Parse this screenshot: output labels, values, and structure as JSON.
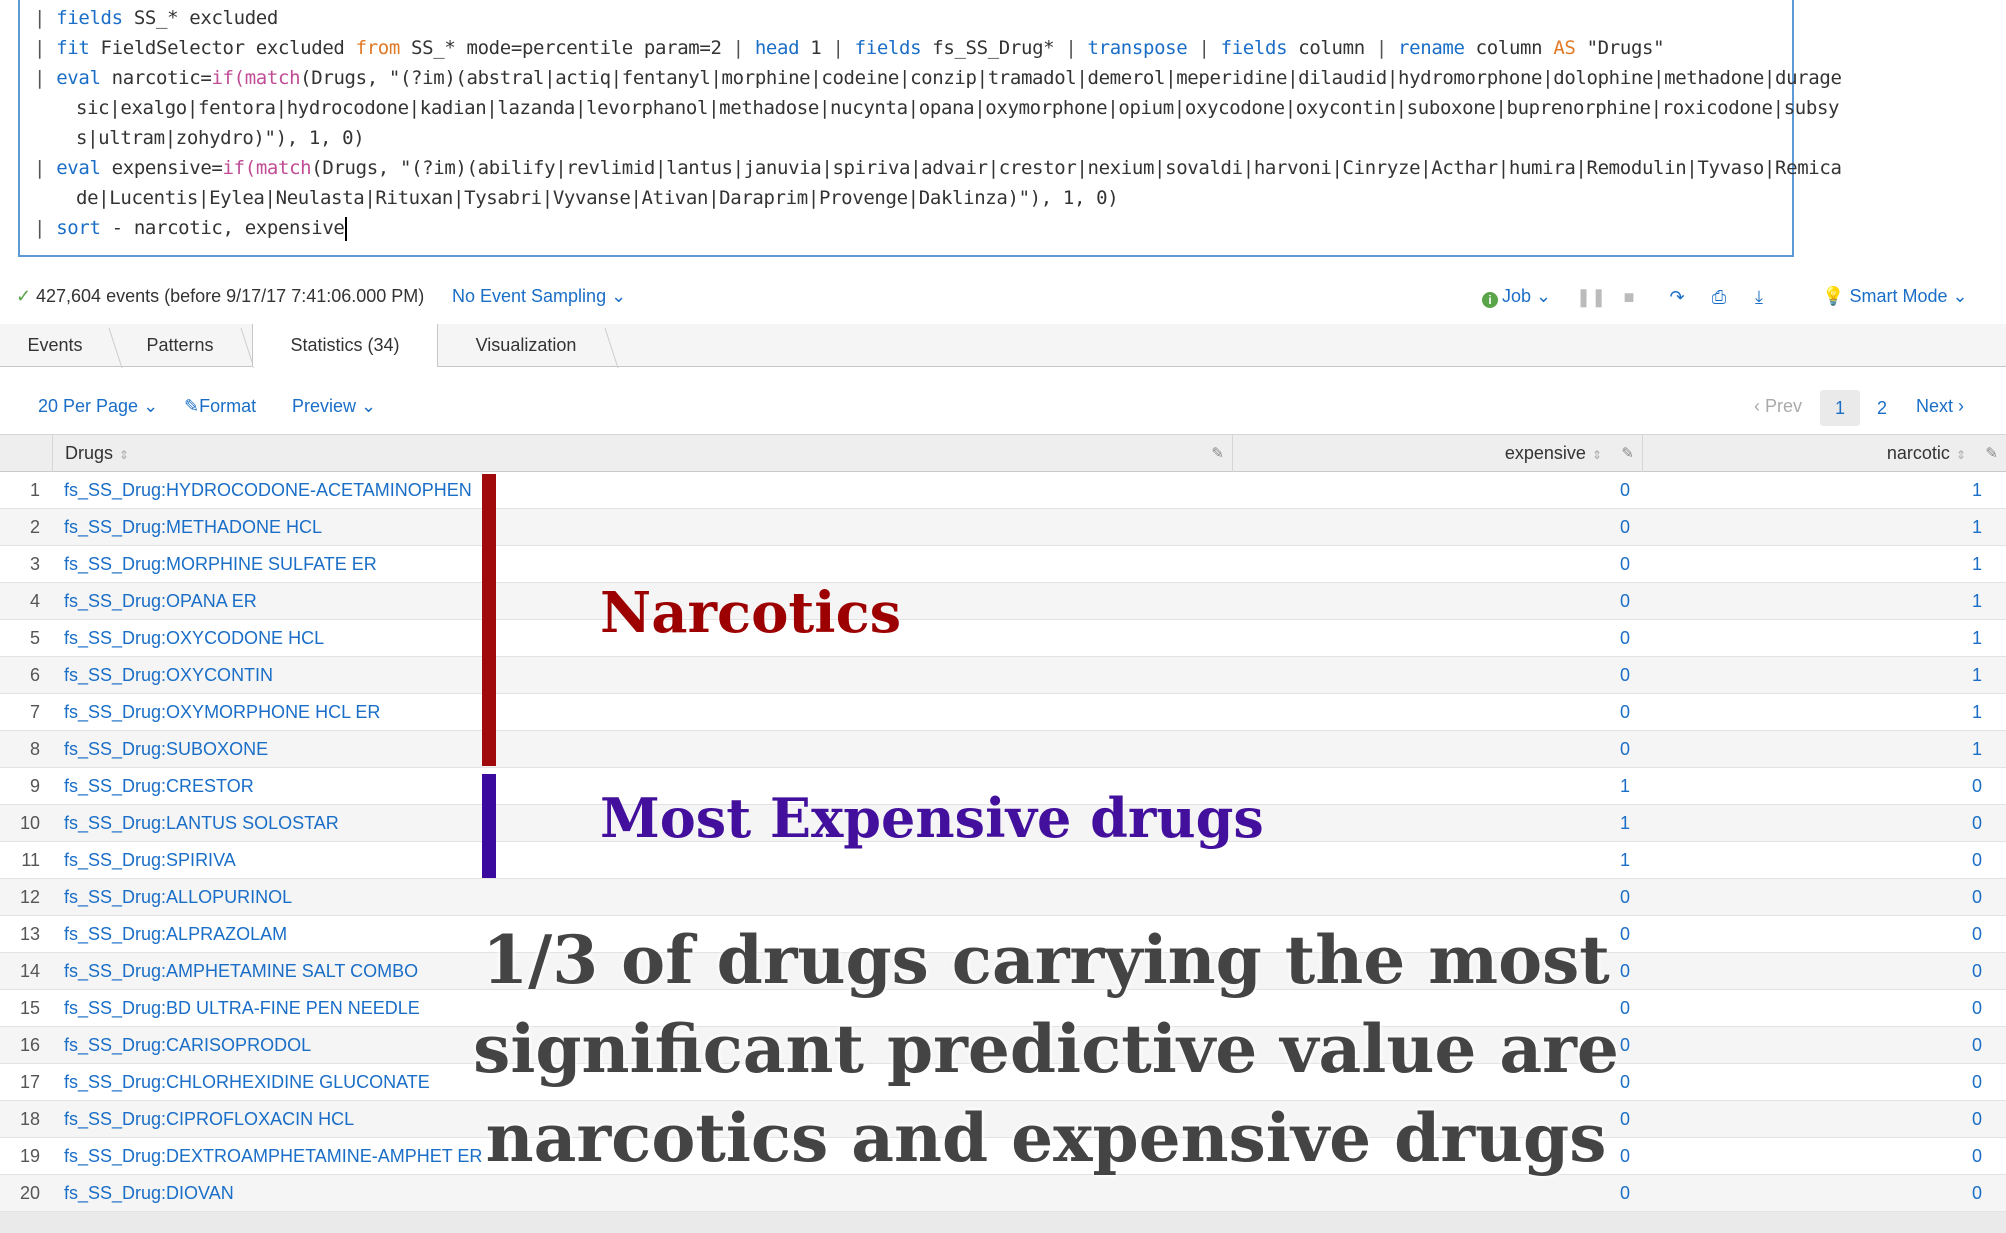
{
  "query": {
    "line1": {
      "pipe": "|",
      "kw": "fields",
      "rest": " SS_* excluded"
    },
    "line2": {
      "pipe": "|",
      "kw1": "fit",
      "t1": " FieldSelector excluded ",
      "op1": "from",
      "t2": " SS_* mode=percentile param=2 ",
      "p2": "|",
      "kw2": " head",
      "t3": " 1 ",
      "p3": "|",
      "kw3": " fields",
      "t4": " fs_SS_Drug* ",
      "p4": "|",
      "kw4": " transpose",
      "t5": " ",
      "p5": "|",
      "kw5": " fields",
      "t6": " column ",
      "p6": "|",
      "kw6": " rename",
      "t7": " column ",
      "op2": "AS",
      "t8": " \"Drugs\""
    },
    "line3": {
      "pipe": "|",
      "kw": "eval",
      "t1": " narcotic=",
      "fn1": "if(",
      "fn2": "match",
      "t2": "(Drugs, \"(?im)(abstral|actiq|fentanyl|morphine|codeine|conzip|tramadol|demerol|meperidine|dilaudid|hydromorphone|dolophine|methadone|durage"
    },
    "line4": "sic|exalgo|fentora|hydrocodone|kadian|lazanda|levorphanol|methadose|nucynta|opana|oxymorphone|opium|oxycodone|oxycontin|suboxone|buprenorphine|roxicodone|subsy",
    "line5": "s|ultram|zohydro)\"), 1, 0)",
    "line6": {
      "pipe": "|",
      "kw": "eval",
      "t1": " expensive=",
      "fn1": "if(",
      "fn2": "match",
      "t2": "(Drugs, \"(?im)(abilify|revlimid|lantus|januvia|spiriva|advair|crestor|nexium|sovaldi|harvoni|Cinryze|Acthar|humira|Remodulin|Tyvaso|Remica"
    },
    "line7": "de|Lucentis|Eylea|Neulasta|Rituxan|Tysabri|Vyvanse|Ativan|Daraprim|Provenge|Daklinza)\"), 1, 0)",
    "line8": {
      "pipe": "|",
      "kw": "sort",
      "rest": " - narcotic, expensive"
    }
  },
  "status": {
    "event_count": "427,604 events (before 9/17/17 7:41:06.000 PM)",
    "sampling": "No Event Sampling",
    "job": "Job",
    "smart_mode": "Smart Mode"
  },
  "tabs": [
    {
      "label": "Events"
    },
    {
      "label": "Patterns"
    },
    {
      "label": "Statistics (34)"
    },
    {
      "label": "Visualization"
    }
  ],
  "toolbar": {
    "per_page": "20 Per Page",
    "format": "Format",
    "preview": "Preview",
    "prev": "Prev",
    "page1": "1",
    "page2": "2",
    "next": "Next"
  },
  "table": {
    "headers": {
      "drugs": "Drugs",
      "expensive": "expensive",
      "narcotic": "narcotic"
    },
    "rows": [
      {
        "n": "1",
        "drug": "fs_SS_Drug:HYDROCODONE-ACETAMINOPHEN",
        "expensive": "0",
        "narcotic": "1"
      },
      {
        "n": "2",
        "drug": "fs_SS_Drug:METHADONE HCL",
        "expensive": "0",
        "narcotic": "1"
      },
      {
        "n": "3",
        "drug": "fs_SS_Drug:MORPHINE SULFATE ER",
        "expensive": "0",
        "narcotic": "1"
      },
      {
        "n": "4",
        "drug": "fs_SS_Drug:OPANA ER",
        "expensive": "0",
        "narcotic": "1"
      },
      {
        "n": "5",
        "drug": "fs_SS_Drug:OXYCODONE HCL",
        "expensive": "0",
        "narcotic": "1"
      },
      {
        "n": "6",
        "drug": "fs_SS_Drug:OXYCONTIN",
        "expensive": "0",
        "narcotic": "1"
      },
      {
        "n": "7",
        "drug": "fs_SS_Drug:OXYMORPHONE HCL ER",
        "expensive": "0",
        "narcotic": "1"
      },
      {
        "n": "8",
        "drug": "fs_SS_Drug:SUBOXONE",
        "expensive": "0",
        "narcotic": "1"
      },
      {
        "n": "9",
        "drug": "fs_SS_Drug:CRESTOR",
        "expensive": "1",
        "narcotic": "0"
      },
      {
        "n": "10",
        "drug": "fs_SS_Drug:LANTUS SOLOSTAR",
        "expensive": "1",
        "narcotic": "0"
      },
      {
        "n": "11",
        "drug": "fs_SS_Drug:SPIRIVA",
        "expensive": "1",
        "narcotic": "0"
      },
      {
        "n": "12",
        "drug": "fs_SS_Drug:ALLOPURINOL",
        "expensive": "0",
        "narcotic": "0"
      },
      {
        "n": "13",
        "drug": "fs_SS_Drug:ALPRAZOLAM",
        "expensive": "0",
        "narcotic": "0"
      },
      {
        "n": "14",
        "drug": "fs_SS_Drug:AMPHETAMINE SALT COMBO",
        "expensive": "0",
        "narcotic": "0"
      },
      {
        "n": "15",
        "drug": "fs_SS_Drug:BD ULTRA-FINE PEN NEEDLE",
        "expensive": "0",
        "narcotic": "0"
      },
      {
        "n": "16",
        "drug": "fs_SS_Drug:CARISOPRODOL",
        "expensive": "0",
        "narcotic": "0"
      },
      {
        "n": "17",
        "drug": "fs_SS_Drug:CHLORHEXIDINE GLUCONATE",
        "expensive": "0",
        "narcotic": "0"
      },
      {
        "n": "18",
        "drug": "fs_SS_Drug:CIPROFLOXACIN HCL",
        "expensive": "0",
        "narcotic": "0"
      },
      {
        "n": "19",
        "drug": "fs_SS_Drug:DEXTROAMPHETAMINE-AMPHET ER",
        "expensive": "0",
        "narcotic": "0"
      },
      {
        "n": "20",
        "drug": "fs_SS_Drug:DIOVAN",
        "expensive": "0",
        "narcotic": "0"
      }
    ]
  },
  "annotations": {
    "narcotics_label": "Narcotics",
    "expensive_label": "Most Expensive drugs",
    "callout": "1/3 of drugs carrying the most significant predictive value are narcotics and expensive drugs",
    "narcotics_color": "#9c0000",
    "expensive_color": "#42109c"
  }
}
